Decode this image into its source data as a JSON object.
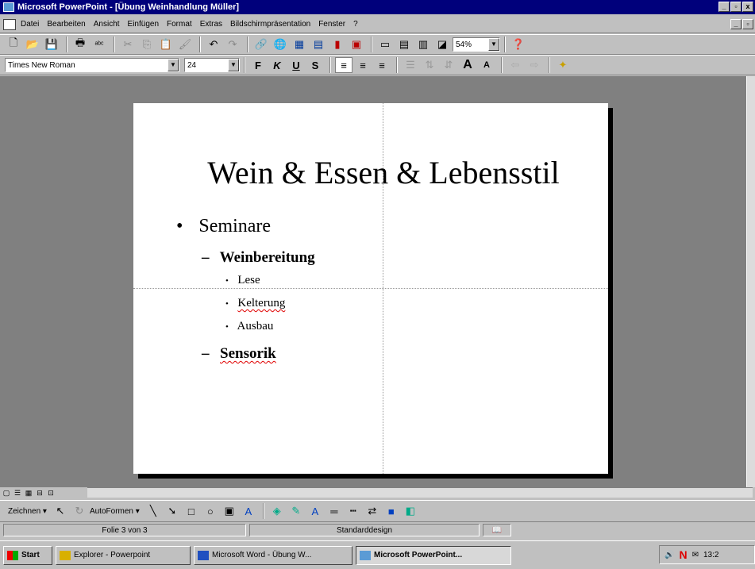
{
  "window": {
    "title": "Microsoft PowerPoint - [Übung Weinhandlung Müller]",
    "minimize": "_",
    "restore": "▫",
    "close": "x"
  },
  "menu": [
    "Datei",
    "Bearbeiten",
    "Ansicht",
    "Einfügen",
    "Format",
    "Extras",
    "Bildschirmpräsentation",
    "Fenster",
    "?"
  ],
  "toolbar": {
    "zoom": "54%",
    "font": "Times New Roman",
    "size": "24",
    "bold": "F",
    "italic": "K",
    "underline": "U",
    "shadow": "S",
    "grow_font": "A",
    "shrink_font": "A"
  },
  "slide": {
    "title": "Wein & Essen & Lebensstil",
    "bullets": [
      {
        "level": 1,
        "marker": "•",
        "text": "Seminare"
      },
      {
        "level": 2,
        "marker": "–",
        "text": "Weinbereitung"
      },
      {
        "level": 3,
        "marker": "•",
        "text": "Lese"
      },
      {
        "level": 3,
        "marker": "•",
        "text": "Kelterung"
      },
      {
        "level": 3,
        "marker": "•",
        "text": "Ausbau"
      },
      {
        "level": 2,
        "marker": "–",
        "text": "Sensorik"
      }
    ]
  },
  "drawbar": {
    "draw": "Zeichnen",
    "autoshapes": "AutoFormen"
  },
  "status": {
    "slide": "Folie 3 von 3",
    "design": "Standarddesign"
  },
  "taskbar": {
    "start": "Start",
    "tasks": [
      {
        "label": "Explorer - Powerpoint",
        "icon": "explorer-icon"
      },
      {
        "label": "Microsoft Word - Übung W...",
        "icon": "word-icon"
      },
      {
        "label": "Microsoft PowerPoint...",
        "icon": "powerpoint-icon"
      }
    ],
    "clock": "13:2"
  },
  "colors": {
    "titlebar": "#00007b",
    "spellcheck_underline": "#e00000",
    "workspace": "#808080"
  }
}
